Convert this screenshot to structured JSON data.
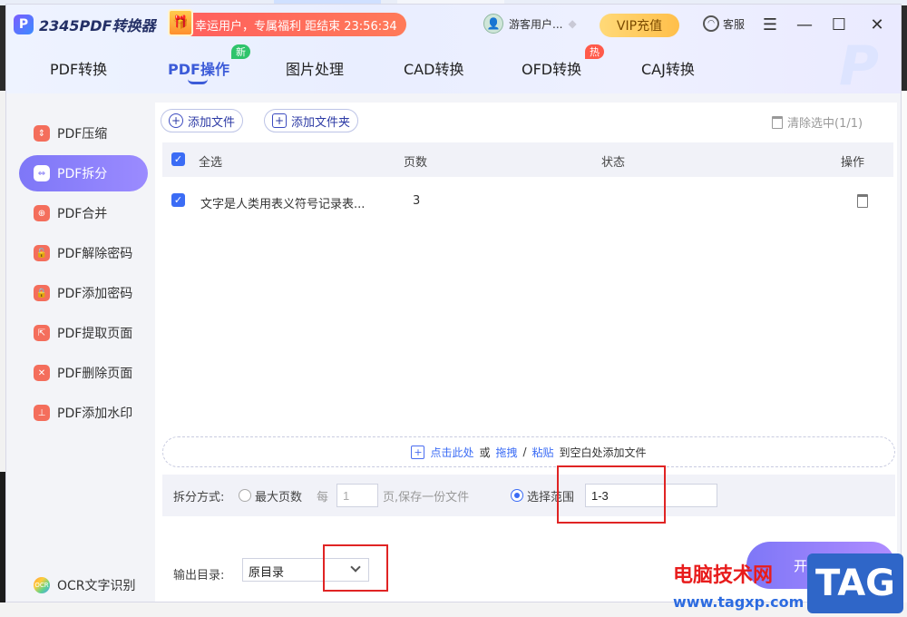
{
  "app": {
    "logo_mark": "P",
    "logo_text": "2345PDF转换器"
  },
  "promo": {
    "text": "幸运用户，专属福利 距结束 23:56:34"
  },
  "user": {
    "name": "游客用户..."
  },
  "vip_label": "VIP充值",
  "service_label": "客服",
  "window_buttons": {
    "menu": "☰",
    "minimize": "—",
    "maximize": "☐",
    "close": "✕"
  },
  "nav_tabs": [
    {
      "label": "PDF转换"
    },
    {
      "label": "PDF操作",
      "badge": "新",
      "active": true
    },
    {
      "label": "图片处理"
    },
    {
      "label": "CAD转换"
    },
    {
      "label": "OFD转换",
      "badge": "热"
    },
    {
      "label": "CAJ转换"
    }
  ],
  "sidebar": {
    "items": [
      {
        "label": "PDF压缩"
      },
      {
        "label": "PDF拆分",
        "active": true
      },
      {
        "label": "PDF合并"
      },
      {
        "label": "PDF解除密码"
      },
      {
        "label": "PDF添加密码"
      },
      {
        "label": "PDF提取页面"
      },
      {
        "label": "PDF删除页面"
      },
      {
        "label": "PDF添加水印"
      }
    ],
    "ocr_label": "OCR文字识别"
  },
  "toolbar": {
    "add_file": "添加文件",
    "add_folder": "添加文件夹",
    "clear_selected": "清除选中(1/1)"
  },
  "table": {
    "headers": {
      "select_all": "全选",
      "pages": "页数",
      "status": "状态",
      "actions": "操作"
    },
    "rows": [
      {
        "name": "文字是人类用表义符号记录表...",
        "pages": "3",
        "status": ""
      }
    ]
  },
  "dropzone": {
    "click": "点击此处",
    "or": "或",
    "drag": "拖拽",
    "slash": "/",
    "paste": "粘贴",
    "rest": "到空白处添加文件"
  },
  "split_options": {
    "label": "拆分方式:",
    "max_pages_label": "最大页数",
    "every_label": "每",
    "every_value": "1",
    "every_suffix": "页,保存一份文件",
    "range_label": "选择范围",
    "range_value": "1-3",
    "selected": "range"
  },
  "output": {
    "label": "输出目录:",
    "selected": "原目录"
  },
  "start_label": "开始拆分",
  "watermark": {
    "cn": "电脑技术网",
    "url": "www.tagxp.com",
    "tag": "TAG"
  },
  "colors": {
    "accent": "#3c5bd8",
    "active_gradient_start": "#7e77f7",
    "highlight_red": "#e02424"
  }
}
